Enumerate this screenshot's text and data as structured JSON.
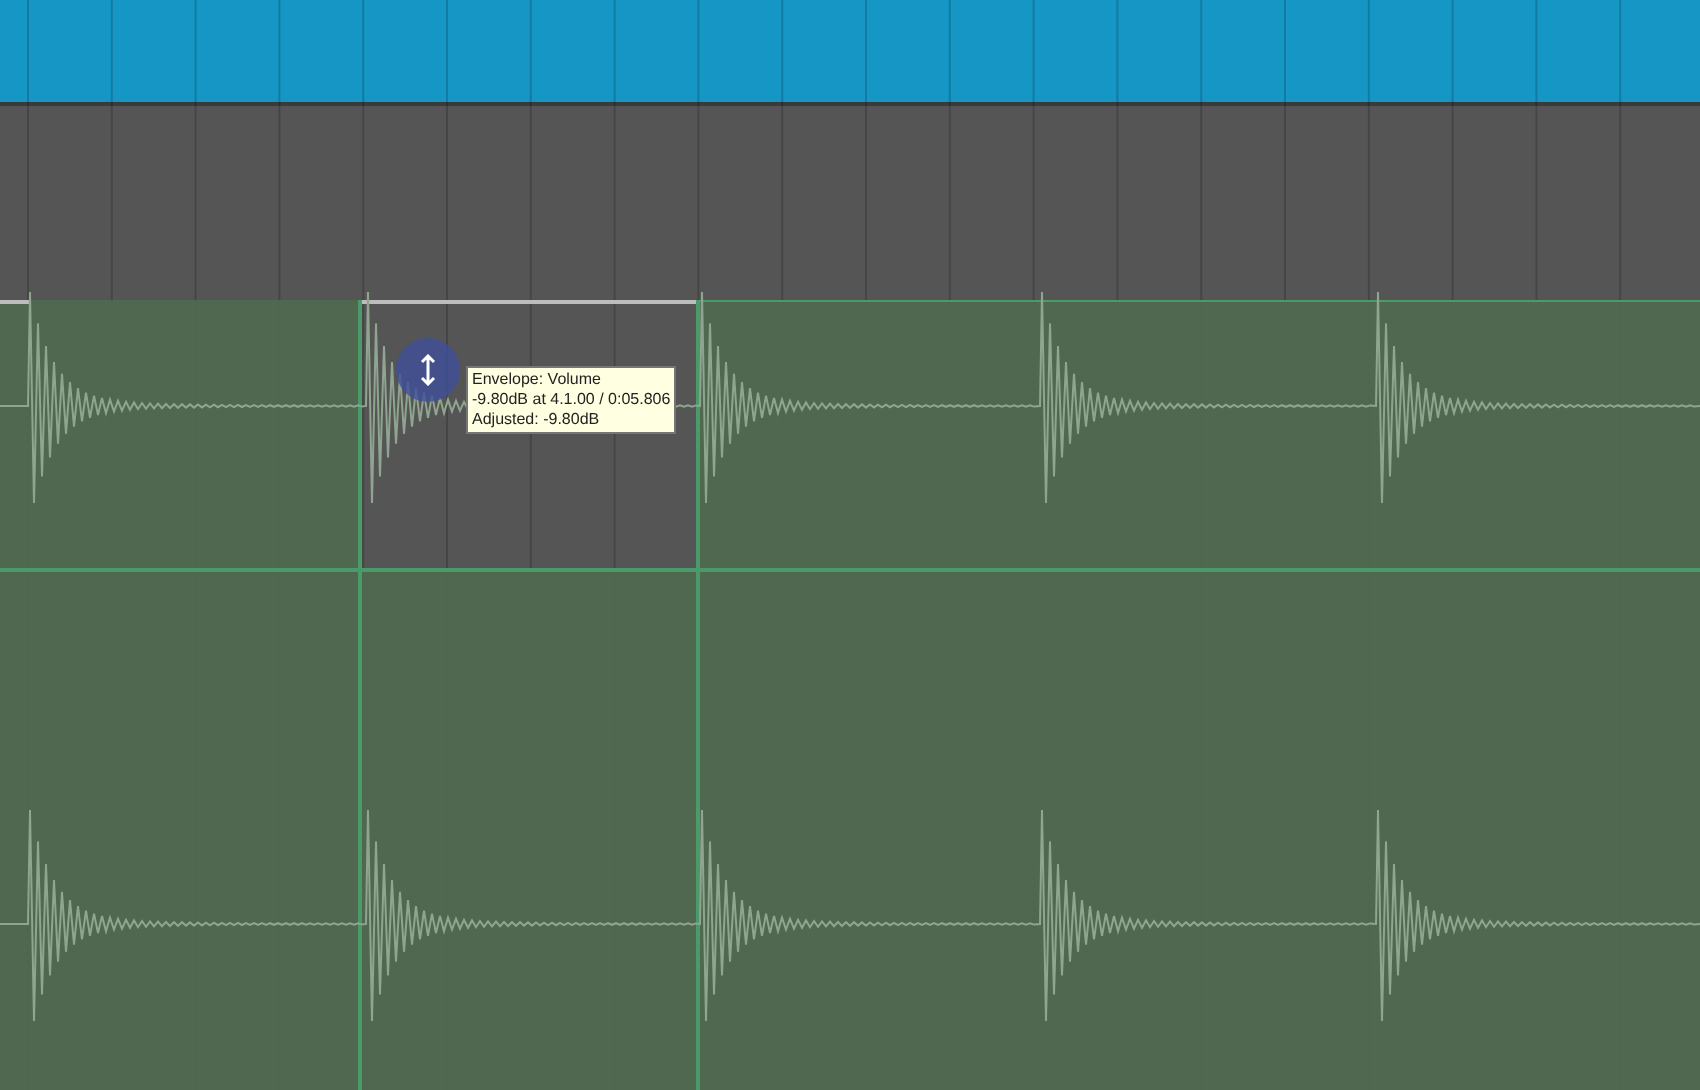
{
  "tooltip": {
    "lines": [
      "Envelope: Volume",
      "-9.80dB at 4.1.00 / 0:05.806",
      "Adjusted: -9.80dB"
    ]
  }
}
